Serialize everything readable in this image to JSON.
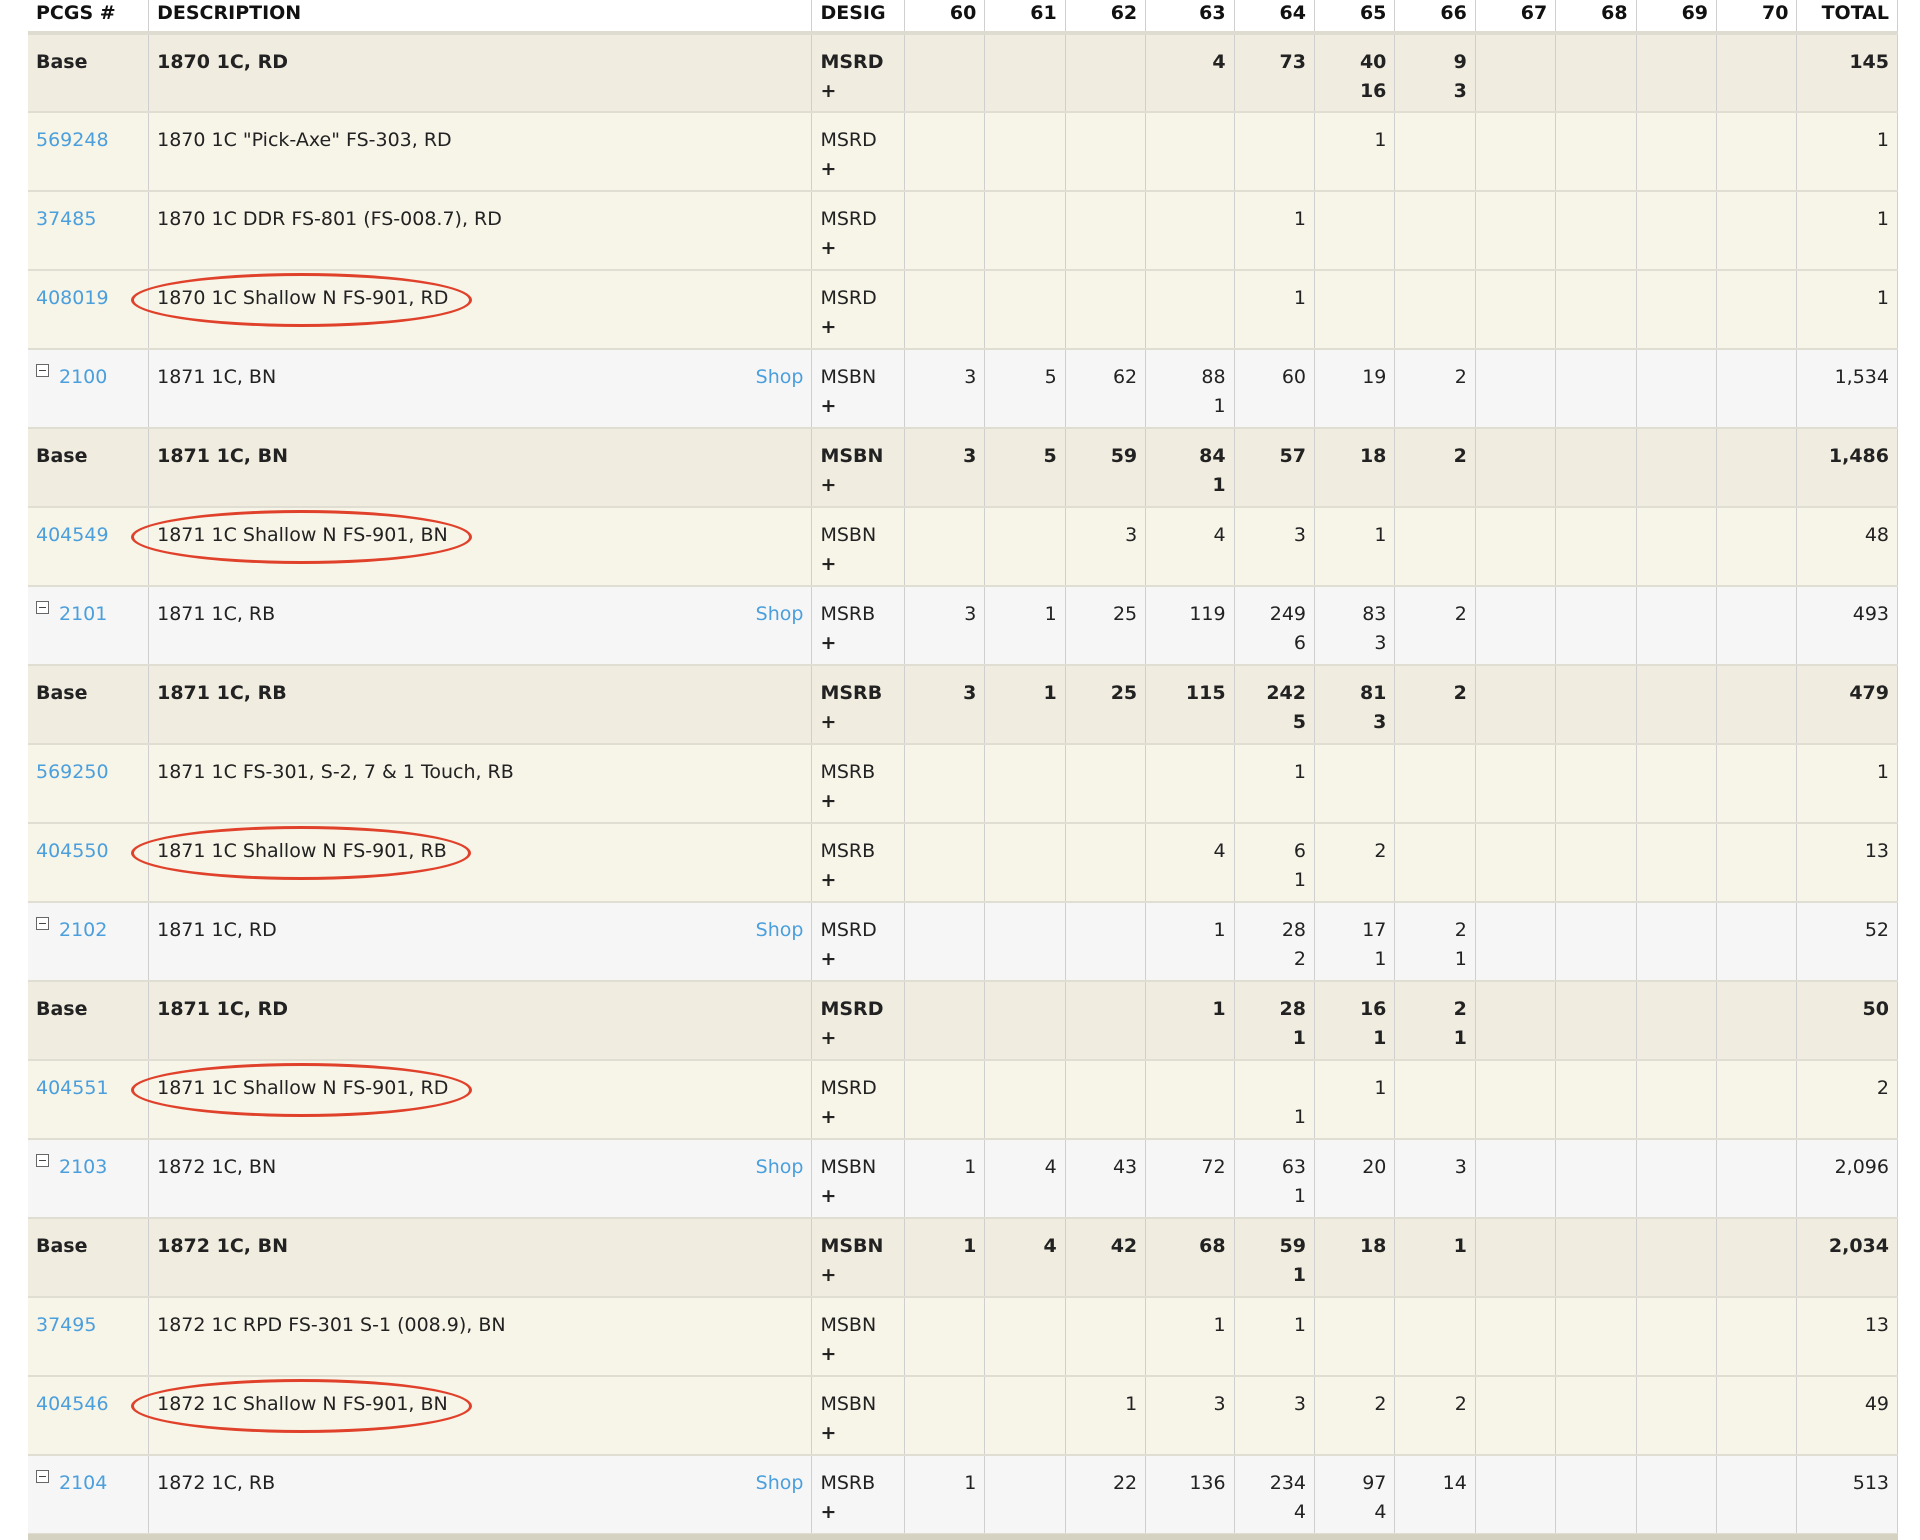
{
  "columns": [
    "PCGS #",
    "DESCRIPTION",
    "DESIG",
    "60",
    "61",
    "62",
    "63",
    "64",
    "65",
    "66",
    "67",
    "68",
    "69",
    "70",
    "TOTAL"
  ],
  "desig_plus": "+",
  "shop_label": "Shop",
  "accent_color": "#4a9fdc",
  "annotation_color": "#e0412a",
  "rows": [
    {
      "kind": "base",
      "pcgs": "Base",
      "desc": "1870 1C, RD",
      "desig": "MSRD",
      "g": [
        [
          "",
          ""
        ],
        [
          "",
          ""
        ],
        [
          "",
          ""
        ],
        [
          "4",
          ""
        ],
        [
          "73",
          ""
        ],
        [
          "40",
          "16"
        ],
        [
          "9",
          "3"
        ],
        [
          "",
          ""
        ],
        [
          "",
          ""
        ],
        [
          "",
          ""
        ],
        [
          "",
          ""
        ]
      ],
      "total": "145",
      "circled": false
    },
    {
      "kind": "var",
      "pcgs": "569248",
      "desc": "1870 1C \"Pick-Axe\" FS-303, RD",
      "desig": "MSRD",
      "g": [
        [
          "",
          ""
        ],
        [
          "",
          ""
        ],
        [
          "",
          ""
        ],
        [
          "",
          ""
        ],
        [
          "",
          ""
        ],
        [
          "1",
          ""
        ],
        [
          "",
          ""
        ],
        [
          "",
          ""
        ],
        [
          "",
          ""
        ],
        [
          "",
          ""
        ],
        [
          "",
          ""
        ]
      ],
      "total": "1",
      "circled": false
    },
    {
      "kind": "var",
      "pcgs": "37485",
      "desc": "1870 1C DDR FS-801 (FS-008.7), RD",
      "desig": "MSRD",
      "g": [
        [
          "",
          ""
        ],
        [
          "",
          ""
        ],
        [
          "",
          ""
        ],
        [
          "",
          ""
        ],
        [
          "1",
          ""
        ],
        [
          "",
          ""
        ],
        [
          "",
          ""
        ],
        [
          "",
          ""
        ],
        [
          "",
          ""
        ],
        [
          "",
          ""
        ],
        [
          "",
          ""
        ]
      ],
      "total": "1",
      "circled": false
    },
    {
      "kind": "var",
      "pcgs": "408019",
      "desc": "1870 1C Shallow N FS-901, RD",
      "desig": "MSRD",
      "g": [
        [
          "",
          ""
        ],
        [
          "",
          ""
        ],
        [
          "",
          ""
        ],
        [
          "",
          ""
        ],
        [
          "1",
          ""
        ],
        [
          "",
          ""
        ],
        [
          "",
          ""
        ],
        [
          "",
          ""
        ],
        [
          "",
          ""
        ],
        [
          "",
          ""
        ],
        [
          "",
          ""
        ]
      ],
      "total": "1",
      "circled": true
    },
    {
      "kind": "parent",
      "pcgs": "2100",
      "desc": "1871 1C, BN",
      "desig": "MSBN",
      "shop": true,
      "g": [
        [
          "3",
          ""
        ],
        [
          "5",
          ""
        ],
        [
          "62",
          ""
        ],
        [
          "88",
          "1"
        ],
        [
          "60",
          ""
        ],
        [
          "19",
          ""
        ],
        [
          "2",
          ""
        ],
        [
          "",
          ""
        ],
        [
          "",
          ""
        ],
        [
          "",
          ""
        ],
        [
          "",
          ""
        ]
      ],
      "total": "1,534",
      "circled": false
    },
    {
      "kind": "base",
      "pcgs": "Base",
      "desc": "1871 1C, BN",
      "desig": "MSBN",
      "g": [
        [
          "3",
          ""
        ],
        [
          "5",
          ""
        ],
        [
          "59",
          ""
        ],
        [
          "84",
          "1"
        ],
        [
          "57",
          ""
        ],
        [
          "18",
          ""
        ],
        [
          "2",
          ""
        ],
        [
          "",
          ""
        ],
        [
          "",
          ""
        ],
        [
          "",
          ""
        ],
        [
          "",
          ""
        ]
      ],
      "total": "1,486",
      "circled": false
    },
    {
      "kind": "var",
      "pcgs": "404549",
      "desc": "1871 1C Shallow N FS-901, BN",
      "desig": "MSBN",
      "g": [
        [
          "",
          ""
        ],
        [
          "",
          ""
        ],
        [
          "3",
          ""
        ],
        [
          "4",
          ""
        ],
        [
          "3",
          ""
        ],
        [
          "1",
          ""
        ],
        [
          "",
          ""
        ],
        [
          "",
          ""
        ],
        [
          "",
          ""
        ],
        [
          "",
          ""
        ],
        [
          "",
          ""
        ]
      ],
      "total": "48",
      "circled": true
    },
    {
      "kind": "parent",
      "pcgs": "2101",
      "desc": "1871 1C, RB",
      "desig": "MSRB",
      "shop": true,
      "g": [
        [
          "3",
          ""
        ],
        [
          "1",
          ""
        ],
        [
          "25",
          ""
        ],
        [
          "119",
          ""
        ],
        [
          "249",
          "6"
        ],
        [
          "83",
          "3"
        ],
        [
          "2",
          ""
        ],
        [
          "",
          ""
        ],
        [
          "",
          ""
        ],
        [
          "",
          ""
        ],
        [
          "",
          ""
        ]
      ],
      "total": "493",
      "circled": false
    },
    {
      "kind": "base",
      "pcgs": "Base",
      "desc": "1871 1C, RB",
      "desig": "MSRB",
      "g": [
        [
          "3",
          ""
        ],
        [
          "1",
          ""
        ],
        [
          "25",
          ""
        ],
        [
          "115",
          ""
        ],
        [
          "242",
          "5"
        ],
        [
          "81",
          "3"
        ],
        [
          "2",
          ""
        ],
        [
          "",
          ""
        ],
        [
          "",
          ""
        ],
        [
          "",
          ""
        ],
        [
          "",
          ""
        ]
      ],
      "total": "479",
      "circled": false
    },
    {
      "kind": "var",
      "pcgs": "569250",
      "desc": "1871 1C FS-301, S-2, 7 & 1 Touch, RB",
      "desig": "MSRB",
      "g": [
        [
          "",
          ""
        ],
        [
          "",
          ""
        ],
        [
          "",
          ""
        ],
        [
          "",
          ""
        ],
        [
          "1",
          ""
        ],
        [
          "",
          ""
        ],
        [
          "",
          ""
        ],
        [
          "",
          ""
        ],
        [
          "",
          ""
        ],
        [
          "",
          ""
        ],
        [
          "",
          ""
        ]
      ],
      "total": "1",
      "circled": false
    },
    {
      "kind": "var",
      "pcgs": "404550",
      "desc": "1871 1C Shallow N FS-901, RB",
      "desig": "MSRB",
      "g": [
        [
          "",
          ""
        ],
        [
          "",
          ""
        ],
        [
          "",
          ""
        ],
        [
          "4",
          ""
        ],
        [
          "6",
          "1"
        ],
        [
          "2",
          ""
        ],
        [
          "",
          ""
        ],
        [
          "",
          ""
        ],
        [
          "",
          ""
        ],
        [
          "",
          ""
        ],
        [
          "",
          ""
        ]
      ],
      "total": "13",
      "circled": true
    },
    {
      "kind": "parent",
      "pcgs": "2102",
      "desc": "1871 1C, RD",
      "desig": "MSRD",
      "shop": true,
      "g": [
        [
          "",
          ""
        ],
        [
          "",
          ""
        ],
        [
          "",
          ""
        ],
        [
          "1",
          ""
        ],
        [
          "28",
          "2"
        ],
        [
          "17",
          "1"
        ],
        [
          "2",
          "1"
        ],
        [
          "",
          ""
        ],
        [
          "",
          ""
        ],
        [
          "",
          ""
        ],
        [
          "",
          ""
        ]
      ],
      "total": "52",
      "circled": false
    },
    {
      "kind": "base",
      "pcgs": "Base",
      "desc": "1871 1C, RD",
      "desig": "MSRD",
      "g": [
        [
          "",
          ""
        ],
        [
          "",
          ""
        ],
        [
          "",
          ""
        ],
        [
          "1",
          ""
        ],
        [
          "28",
          "1"
        ],
        [
          "16",
          "1"
        ],
        [
          "2",
          "1"
        ],
        [
          "",
          ""
        ],
        [
          "",
          ""
        ],
        [
          "",
          ""
        ],
        [
          "",
          ""
        ]
      ],
      "total": "50",
      "circled": false
    },
    {
      "kind": "var",
      "pcgs": "404551",
      "desc": "1871 1C Shallow N FS-901, RD",
      "desig": "MSRD",
      "g": [
        [
          "",
          ""
        ],
        [
          "",
          ""
        ],
        [
          "",
          ""
        ],
        [
          "",
          ""
        ],
        [
          "",
          "1"
        ],
        [
          "1",
          ""
        ],
        [
          "",
          ""
        ],
        [
          "",
          ""
        ],
        [
          "",
          ""
        ],
        [
          "",
          ""
        ],
        [
          "",
          ""
        ]
      ],
      "total": "2",
      "circled": true
    },
    {
      "kind": "parent",
      "pcgs": "2103",
      "desc": "1872 1C, BN",
      "desig": "MSBN",
      "shop": true,
      "g": [
        [
          "1",
          ""
        ],
        [
          "4",
          ""
        ],
        [
          "43",
          ""
        ],
        [
          "72",
          ""
        ],
        [
          "63",
          "1"
        ],
        [
          "20",
          ""
        ],
        [
          "3",
          ""
        ],
        [
          "",
          ""
        ],
        [
          "",
          ""
        ],
        [
          "",
          ""
        ],
        [
          "",
          ""
        ]
      ],
      "total": "2,096",
      "circled": false
    },
    {
      "kind": "base",
      "pcgs": "Base",
      "desc": "1872 1C, BN",
      "desig": "MSBN",
      "g": [
        [
          "1",
          ""
        ],
        [
          "4",
          ""
        ],
        [
          "42",
          ""
        ],
        [
          "68",
          ""
        ],
        [
          "59",
          "1"
        ],
        [
          "18",
          ""
        ],
        [
          "1",
          ""
        ],
        [
          "",
          ""
        ],
        [
          "",
          ""
        ],
        [
          "",
          ""
        ],
        [
          "",
          ""
        ]
      ],
      "total": "2,034",
      "circled": false
    },
    {
      "kind": "var",
      "pcgs": "37495",
      "desc": "1872 1C RPD FS-301 S-1 (008.9), BN",
      "desig": "MSBN",
      "g": [
        [
          "",
          ""
        ],
        [
          "",
          ""
        ],
        [
          "",
          ""
        ],
        [
          "1",
          ""
        ],
        [
          "1",
          ""
        ],
        [
          "",
          ""
        ],
        [
          "",
          ""
        ],
        [
          "",
          ""
        ],
        [
          "",
          ""
        ],
        [
          "",
          ""
        ],
        [
          "",
          ""
        ]
      ],
      "total": "13",
      "circled": false
    },
    {
      "kind": "var",
      "pcgs": "404546",
      "desc": "1872 1C Shallow N FS-901, BN",
      "desig": "MSBN",
      "g": [
        [
          "",
          ""
        ],
        [
          "",
          ""
        ],
        [
          "1",
          ""
        ],
        [
          "3",
          ""
        ],
        [
          "3",
          ""
        ],
        [
          "2",
          ""
        ],
        [
          "2",
          ""
        ],
        [
          "",
          ""
        ],
        [
          "",
          ""
        ],
        [
          "",
          ""
        ],
        [
          "",
          ""
        ]
      ],
      "total": "49",
      "circled": true
    },
    {
      "kind": "parent",
      "pcgs": "2104",
      "desc": "1872 1C, RB",
      "desig": "MSRB",
      "shop": true,
      "g": [
        [
          "1",
          ""
        ],
        [
          "",
          ""
        ],
        [
          "22",
          ""
        ],
        [
          "136",
          ""
        ],
        [
          "234",
          "4"
        ],
        [
          "97",
          "4"
        ],
        [
          "14",
          ""
        ],
        [
          "",
          ""
        ],
        [
          "",
          ""
        ],
        [
          "",
          ""
        ],
        [
          "",
          ""
        ]
      ],
      "total": "513",
      "circled": false
    }
  ]
}
